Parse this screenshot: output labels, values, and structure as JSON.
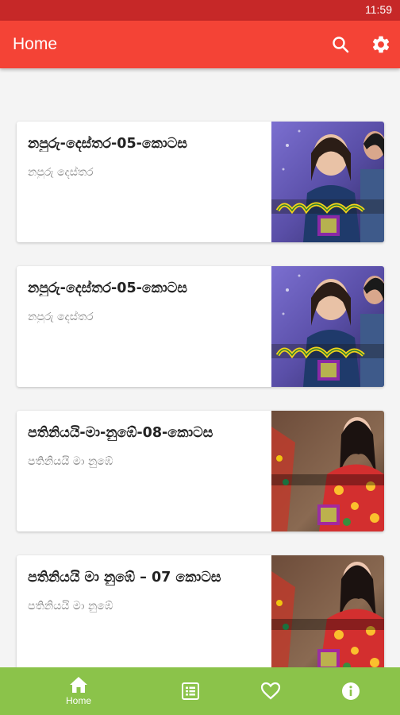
{
  "status_bar": {
    "time": "11:59"
  },
  "app_bar": {
    "title": "Home",
    "search_icon": "search-icon",
    "settings_icon": "gear-icon",
    "color": "#f44336"
  },
  "cards": [
    {
      "title": "නපුරු-දෙස්තර-05-කොටස",
      "subtitle": "නපුරු දෙස්තර",
      "thumbnail": "napuru-thumbnail"
    },
    {
      "title": "නපුරු-දෙස්තර-05-කොටස",
      "subtitle": "නපුරු දෙස්තර",
      "thumbnail": "napuru-thumbnail"
    },
    {
      "title": "පතිනියයි-මා-නුඹේ-08-කොටස",
      "subtitle": "පතිනියයි මා නුඹේ",
      "thumbnail": "pathiniyayi-thumbnail"
    },
    {
      "title": "පතිනියයි මා නුඹේ – 07 කොටස",
      "subtitle": "පතිනියයි මා නුඹේ",
      "thumbnail": "pathiniyayi-thumbnail"
    }
  ],
  "bottom_nav": {
    "color": "#8bc34a",
    "items": [
      {
        "icon": "home-icon",
        "label": "Home",
        "active": true
      },
      {
        "icon": "list-icon",
        "label": ""
      },
      {
        "icon": "heart-icon",
        "label": ""
      },
      {
        "icon": "info-icon",
        "label": ""
      }
    ]
  }
}
